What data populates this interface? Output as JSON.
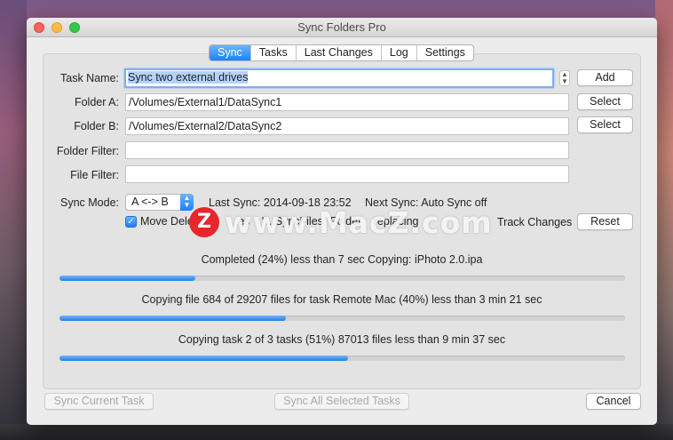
{
  "window": {
    "title": "Sync Folders Pro"
  },
  "tabs": [
    {
      "label": "Sync",
      "active": true
    },
    {
      "label": "Tasks",
      "active": false
    },
    {
      "label": "Last Changes",
      "active": false
    },
    {
      "label": "Log",
      "active": false
    },
    {
      "label": "Settings",
      "active": false
    }
  ],
  "form": {
    "task_name_label": "Task Name:",
    "task_name_value": "Sync two external drives",
    "folder_a_label": "Folder A:",
    "folder_a_value": "/Volumes/External1/DataSync1",
    "folder_b_label": "Folder B:",
    "folder_b_value": "/Volumes/External2/DataSync2",
    "folder_filter_label": "Folder Filter:",
    "folder_filter_value": "",
    "file_filter_label": "File Filter:",
    "file_filter_value": "",
    "sync_mode_label": "Sync Mode:",
    "sync_mode_value": "A <-> B",
    "last_sync": "Last Sync: 2014-09-18 23:52",
    "next_sync": "Next Sync: Auto Sync off",
    "move_deleted_label": "Move Delete",
    "move_deleted_label_tail": "es",
    "move_deleted_folder": "\"...SyncFiles\" Folder",
    "move_deleted_suffix": "replacing",
    "move_deleted_checked": true,
    "track_changes_label": "Track Changes"
  },
  "buttons": {
    "add": "Add",
    "select_a": "Select",
    "select_b": "Select",
    "reset": "Reset",
    "sync_current": "Sync Current Task",
    "sync_all": "Sync All Selected Tasks",
    "cancel": "Cancel"
  },
  "progress": [
    {
      "text": "Completed (24%) less than 7 sec Copying: iPhoto 2.0.ipa",
      "value": 0.24
    },
    {
      "text": "Copying file 684 of 29207 files for task Remote Mac (40%) less than 3 min 21 sec",
      "value": 0.4
    },
    {
      "text": "Copying task 2 of 3 tasks (51%) 87013 files less than 9 min 37 sec",
      "value": 0.51
    }
  ],
  "watermark": {
    "logo_letter": "Z",
    "text": "www.MacZ.com"
  },
  "colors": {
    "accent": "#1a82fb",
    "progress": "#2a7ee6"
  }
}
